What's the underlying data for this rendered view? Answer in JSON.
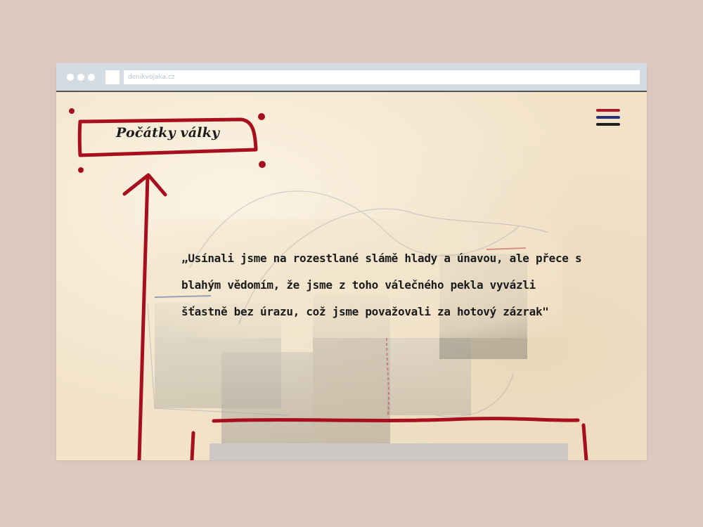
{
  "browser": {
    "url": "denikvojaka.cz"
  },
  "nav": {
    "title": "Počátky války",
    "menu_icon": "hamburger-tricolor-icon"
  },
  "content": {
    "quote": "„Usínali jsme na rozestlané slámě hlady a únavou, ale přece s blahým vědomím, že jsme z toho válečného pekla vyvázli šťastně bez úrazu, což jsme považovali za hotový zázrak\""
  },
  "colors": {
    "accent_red": "#a80f1e",
    "flag_red": "#b01528",
    "flag_blue": "#2c2f7a",
    "flag_black": "#1e1e1e",
    "paper": "#f2e3c9",
    "background": "#dcc8be"
  }
}
